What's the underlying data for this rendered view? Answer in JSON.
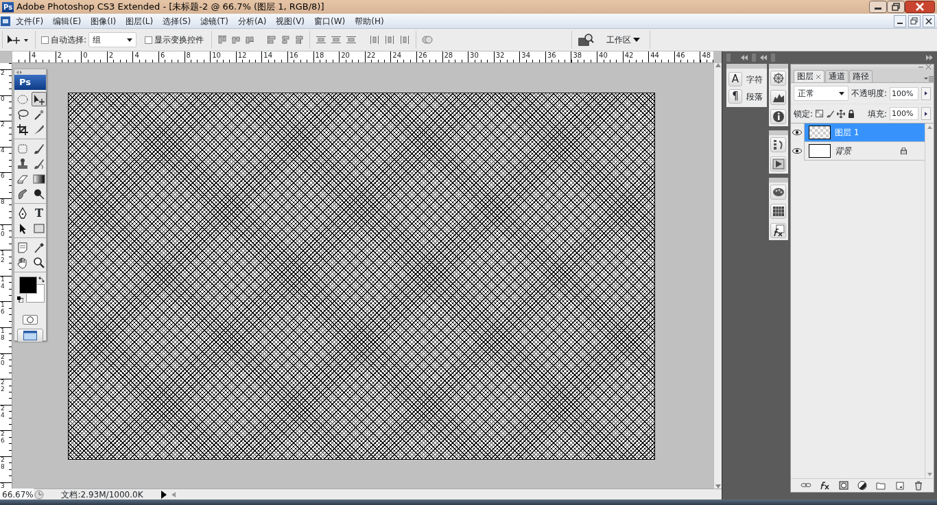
{
  "window": {
    "title": "Adobe Photoshop CS3 Extended - [未标题-2 @ 66.7% (图层 1, RGB/8)]",
    "logo": "Ps"
  },
  "menu": [
    "文件(F)",
    "编辑(E)",
    "图像(I)",
    "图层(L)",
    "选择(S)",
    "滤镜(T)",
    "分析(A)",
    "视图(V)",
    "窗口(W)",
    "帮助(H)"
  ],
  "options_bar": {
    "auto_select": {
      "label": "自动选择:",
      "checked": false
    },
    "auto_select_target": "组",
    "transform_controls": {
      "label": "显示变换控件",
      "checked": false
    },
    "workspace": "工作区"
  },
  "ruler_h": [
    "4",
    "2",
    "0",
    "2",
    "4",
    "6",
    "8",
    "10",
    "12",
    "14",
    "16",
    "18",
    "20",
    "22",
    "24",
    "26",
    "28",
    "30",
    "32",
    "34",
    "36",
    "38",
    "40",
    "42",
    "44",
    "46",
    "48"
  ],
  "ruler_v": [
    "2",
    "0",
    "2",
    "4",
    "6",
    "8",
    "10",
    "12",
    "14",
    "16",
    "18",
    "20",
    "22",
    "24",
    "26",
    "28",
    "3"
  ],
  "toolbox": {
    "logo": "Ps",
    "groups": [
      [
        {
          "kind": "marquee",
          "selected": false
        },
        {
          "kind": "move",
          "selected": true
        },
        {
          "kind": "lasso",
          "selected": false
        },
        {
          "kind": "wand",
          "selected": false
        },
        {
          "kind": "crop",
          "selected": false
        },
        {
          "kind": "slice",
          "selected": false
        }
      ],
      [
        {
          "kind": "heal",
          "selected": false
        },
        {
          "kind": "brush",
          "selected": false
        },
        {
          "kind": "stamp",
          "selected": false
        },
        {
          "kind": "history",
          "selected": false
        },
        {
          "kind": "eraser",
          "selected": false
        },
        {
          "kind": "gradient",
          "selected": false
        },
        {
          "kind": "smudge",
          "selected": false
        },
        {
          "kind": "dodge",
          "selected": false
        }
      ],
      [
        {
          "kind": "pen",
          "selected": false
        },
        {
          "kind": "type",
          "glyph": "T",
          "selected": false
        },
        {
          "kind": "path",
          "selected": false
        },
        {
          "kind": "shape",
          "selected": false
        }
      ],
      [
        {
          "kind": "notes",
          "selected": false
        },
        {
          "kind": "eyedropper",
          "selected": false
        },
        {
          "kind": "hand",
          "selected": false
        },
        {
          "kind": "zoom",
          "selected": false
        }
      ]
    ]
  },
  "text_panels": [
    {
      "glyph": "A",
      "label": "字符"
    },
    {
      "glyph": "¶",
      "label": "段落"
    }
  ],
  "layers_panel": {
    "tabs": [
      {
        "label": "图层",
        "selected": true
      },
      {
        "label": "通道",
        "selected": false
      },
      {
        "label": "路径",
        "selected": false
      }
    ],
    "blend_mode": "正常",
    "opacity_label": "不透明度:",
    "opacity": "100%",
    "lock_label": "锁定:",
    "fill_label": "填充:",
    "fill": "100%",
    "layers": [
      {
        "name": "图层 1",
        "kind": "transparent",
        "visible": true,
        "locked": false,
        "selected": true
      },
      {
        "name": "背景",
        "kind": "background",
        "visible": true,
        "locked": true,
        "selected": false
      }
    ]
  },
  "status_bar": {
    "zoom": "66.67%",
    "doc_info": "文档:2.93M/1000.0K"
  }
}
